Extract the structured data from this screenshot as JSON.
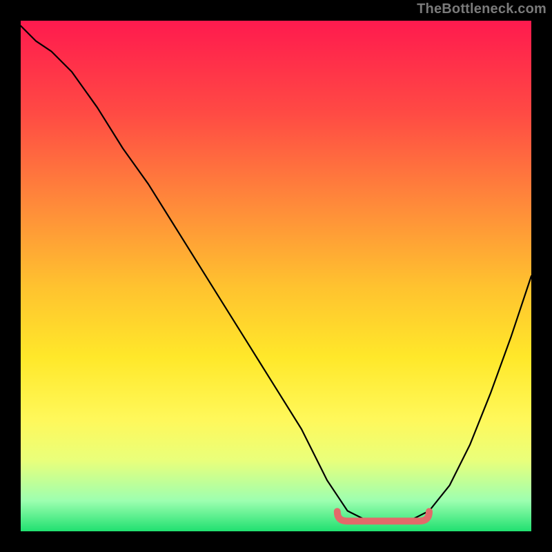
{
  "attribution": "TheBottleneck.com",
  "chart_data": {
    "type": "line",
    "title": "",
    "xlabel": "",
    "ylabel": "",
    "xlim": [
      0,
      100
    ],
    "ylim": [
      0,
      100
    ],
    "x": [
      0,
      3,
      6,
      10,
      15,
      20,
      25,
      30,
      35,
      40,
      45,
      50,
      55,
      58,
      60,
      62,
      64,
      68,
      72,
      76,
      80,
      84,
      88,
      92,
      96,
      100
    ],
    "values": [
      99,
      96,
      94,
      90,
      83,
      75,
      68,
      60,
      52,
      44,
      36,
      28,
      20,
      14,
      10,
      7,
      4,
      2,
      1.5,
      2,
      4,
      9,
      17,
      27,
      38,
      50
    ],
    "optimal_range_x": [
      62,
      80
    ],
    "optimal_range_value": 2,
    "background_gradient_stops": [
      {
        "pos": 0.0,
        "color": "#ff1a4e"
      },
      {
        "pos": 0.18,
        "color": "#ff4a44"
      },
      {
        "pos": 0.36,
        "color": "#ff8a3a"
      },
      {
        "pos": 0.52,
        "color": "#ffc22f"
      },
      {
        "pos": 0.66,
        "color": "#ffe82a"
      },
      {
        "pos": 0.78,
        "color": "#fff85a"
      },
      {
        "pos": 0.86,
        "color": "#eaff7a"
      },
      {
        "pos": 0.94,
        "color": "#9dffb0"
      },
      {
        "pos": 1.0,
        "color": "#20e070"
      }
    ]
  }
}
